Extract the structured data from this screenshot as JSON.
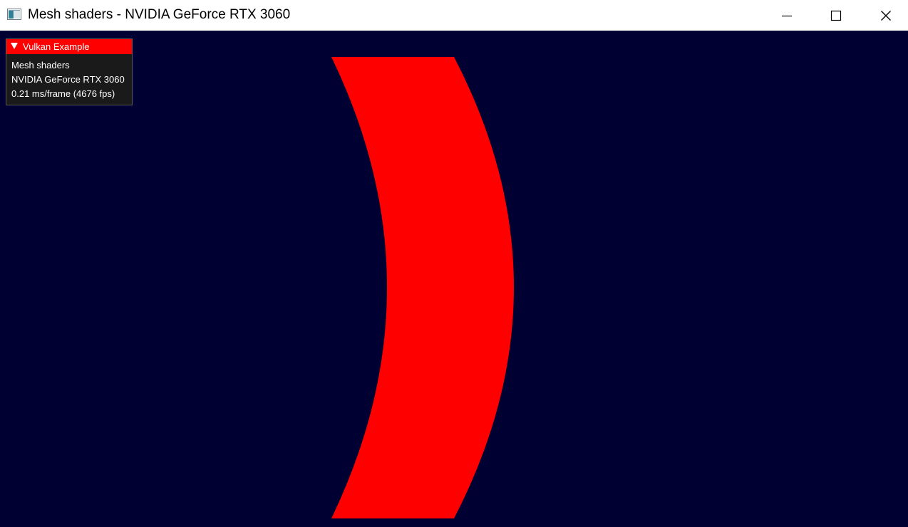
{
  "window": {
    "title": "Mesh shaders - NVIDIA GeForce RTX 3060",
    "icon": "vulkan-app-icon",
    "controls": [
      "minimize-icon",
      "maximize-icon",
      "close-icon"
    ]
  },
  "viewport": {
    "background_color": "#000033",
    "mesh_color": "#ff0000"
  },
  "overlay": {
    "title": "Vulkan Example",
    "header_color": "#ff0000",
    "lines": [
      "Mesh shaders",
      "NVIDIA GeForce RTX 3060",
      "0.21 ms/frame (4676 fps)"
    ]
  }
}
